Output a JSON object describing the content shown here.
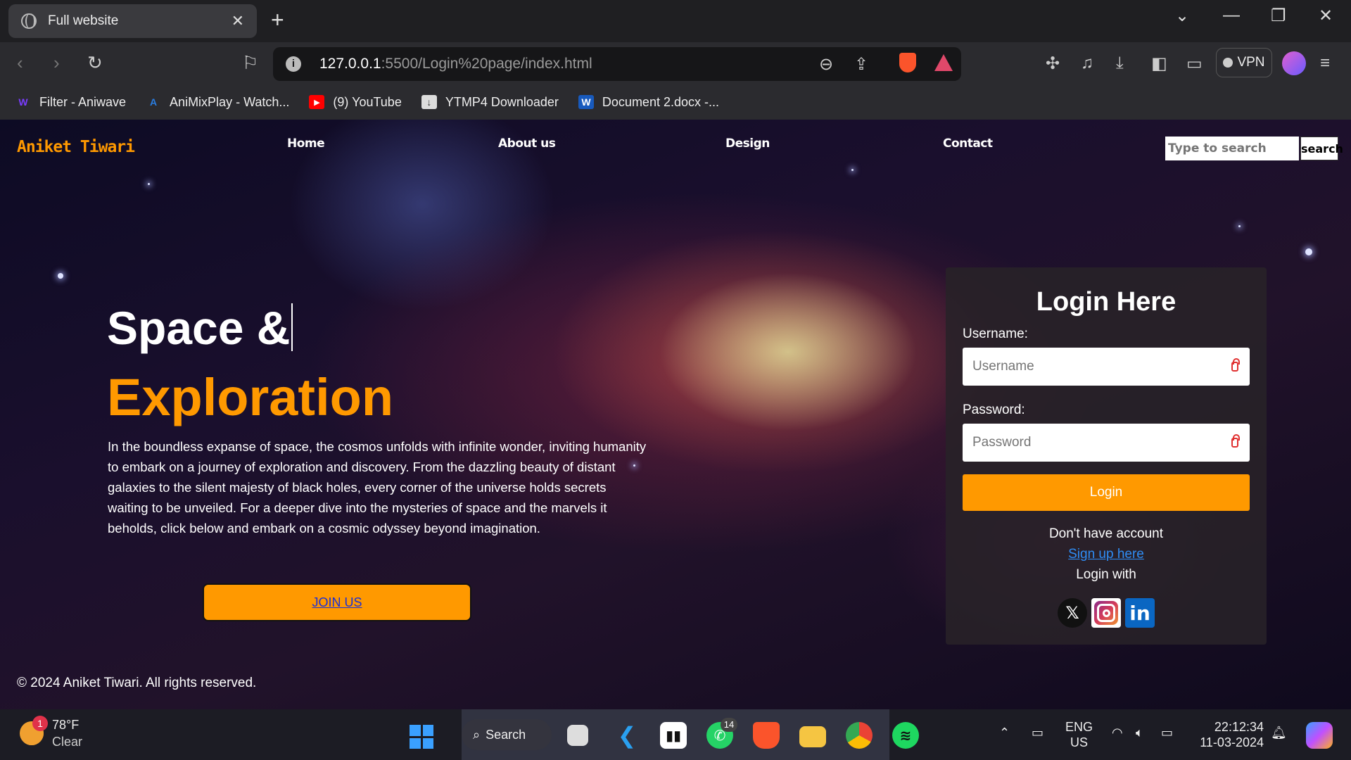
{
  "browser": {
    "tab_title": "Full website",
    "tab_close": "✕",
    "new_tab": "+",
    "url_host": "127.0.0.1",
    "url_path": ":5500/Login%20page/index.html",
    "vpn_label": "VPN",
    "bookmarks": [
      {
        "label": "Filter - Aniwave",
        "icon": "W",
        "color": "#7a3cff"
      },
      {
        "label": "AniMixPlay - Watch...",
        "icon": "A",
        "color": "#2a7de1"
      },
      {
        "label": "(9) YouTube",
        "icon": "▶",
        "color": "#ff0000"
      },
      {
        "label": "YTMP4 Downloader",
        "icon": "↓",
        "color": "#dddddd"
      },
      {
        "label": "Document 2.docx -...",
        "icon": "W",
        "color": "#185abd"
      }
    ]
  },
  "site": {
    "brand": "Aniket Tiwari",
    "nav": [
      "Home",
      "About us",
      "Design",
      "Contact"
    ],
    "search_placeholder": "Type to search",
    "search_button": "search",
    "heading_line1": "Space &",
    "heading_line2": "Exploration",
    "paragraph": "In the boundless expanse of space, the cosmos unfolds with infinite wonder, inviting humanity to embark on a journey of exploration and discovery. From the dazzling beauty of distant galaxies to the silent majesty of black holes, every corner of the universe holds secrets waiting to be unveiled. For a deeper dive into the mysteries of space and the marvels it beholds, click below and embark on a cosmic odyssey beyond imagination.",
    "join_button": "JOIN US",
    "copyright": "© 2024 Aniket Tiwari. All rights reserved."
  },
  "login": {
    "title": "Login Here",
    "username_label": "Username:",
    "username_placeholder": "Username",
    "password_label": "Password:",
    "password_placeholder": "Password",
    "login_button": "Login",
    "no_account": "Don't have account",
    "signup_link": "Sign up here",
    "login_with": "Login with",
    "social": [
      "x-icon",
      "instagram-icon",
      "linkedin-icon"
    ]
  },
  "taskbar": {
    "weather_temp": "78°F",
    "weather_desc": "Clear",
    "weather_badge": "1",
    "search_label": "Search",
    "whatsapp_badge": "14",
    "lang_top": "ENG",
    "lang_bottom": "US",
    "time": "22:12:34",
    "date": "11-03-2024"
  },
  "colors": {
    "accent": "#ff9900",
    "link": "#2f8df5"
  }
}
